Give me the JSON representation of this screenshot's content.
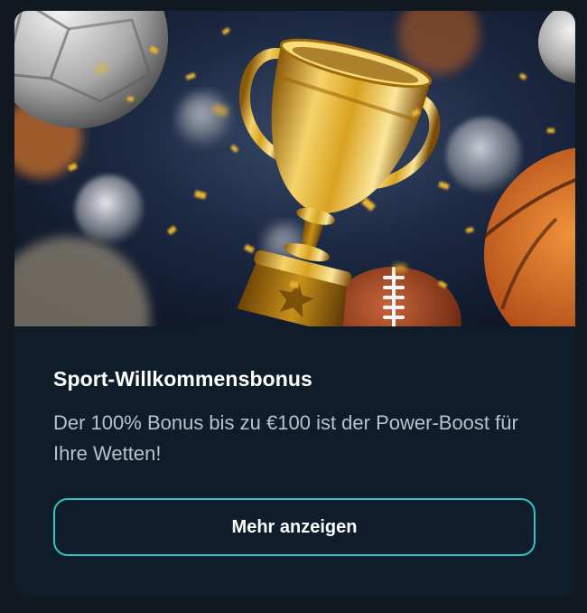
{
  "promo": {
    "image_icon": "trophy-sports-balls-illustration",
    "title": "Sport-Willkommensbonus",
    "description": "Der 100% Bonus bis zu €100 ist der Power-Boost für Ihre Wetten!",
    "cta_label": "Mehr anzeigen"
  },
  "colors": {
    "page_background": "#111820",
    "card_background": "#0f1d2a",
    "title_text": "#ffffff",
    "description_text": "#b8c2cc",
    "button_border": "#2fc4c7",
    "trophy_gold": "#d9a321"
  }
}
